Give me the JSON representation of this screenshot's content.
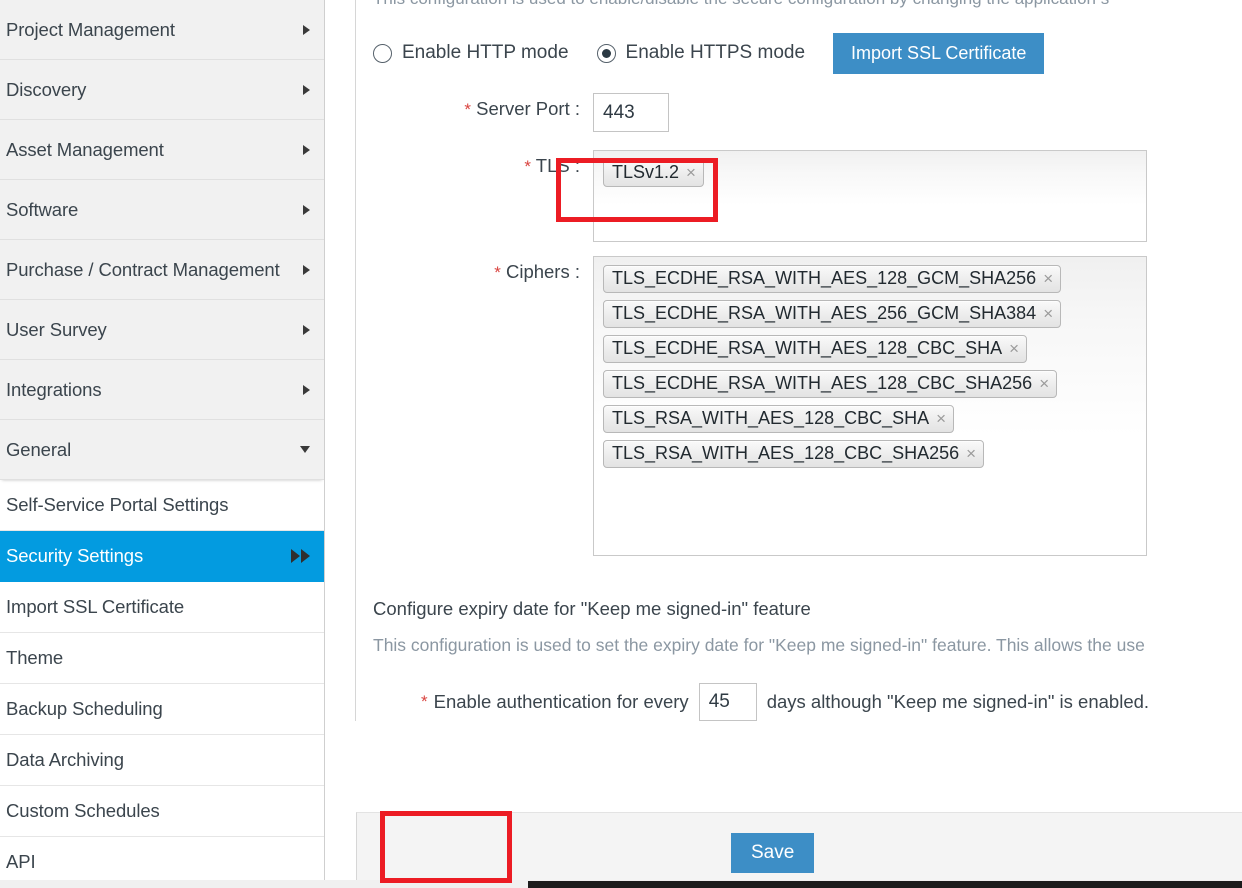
{
  "sidebar": {
    "groups": [
      {
        "label": "Project Management",
        "icon": "chevron-right-icon",
        "expanded": false
      },
      {
        "label": "Discovery",
        "icon": "chevron-right-icon",
        "expanded": false
      },
      {
        "label": "Asset Management",
        "icon": "chevron-right-icon",
        "expanded": false
      },
      {
        "label": "Software",
        "icon": "chevron-right-icon",
        "expanded": false
      },
      {
        "label": "Purchase / Contract Management",
        "icon": "chevron-right-icon",
        "expanded": false
      },
      {
        "label": "User Survey",
        "icon": "chevron-right-icon",
        "expanded": false
      },
      {
        "label": "Integrations",
        "icon": "chevron-right-icon",
        "expanded": false
      },
      {
        "label": "General",
        "icon": "chevron-down-icon",
        "expanded": true
      }
    ],
    "sub_items": [
      {
        "label": "Self-Service Portal Settings",
        "active": false
      },
      {
        "label": "Security Settings",
        "active": true,
        "icon": "double-arrow-right-icon"
      },
      {
        "label": "Import SSL Certificate",
        "active": false
      },
      {
        "label": "Theme",
        "active": false
      },
      {
        "label": "Backup Scheduling",
        "active": false
      },
      {
        "label": "Data Archiving",
        "active": false
      },
      {
        "label": "Custom Schedules",
        "active": false
      },
      {
        "label": "API",
        "active": false
      }
    ],
    "active_color": "#039BE0"
  },
  "main": {
    "top_description": "This configuration is used to enable/disable the secure configuration by changing the application s",
    "http_mode": {
      "label": "Enable HTTP mode",
      "checked": false
    },
    "https_mode": {
      "label": "Enable HTTPS mode",
      "checked": true
    },
    "import_ssl_button": "Import SSL Certificate",
    "server_port": {
      "label": "Server Port :",
      "required": true,
      "value": "443"
    },
    "tls": {
      "label": "TLS :",
      "required": true,
      "tags": [
        "TLSv1.2"
      ],
      "remove_icon": "×"
    },
    "ciphers": {
      "label": "Ciphers :",
      "required": true,
      "tags": [
        "TLS_ECDHE_RSA_WITH_AES_128_GCM_SHA256",
        "TLS_ECDHE_RSA_WITH_AES_256_GCM_SHA384",
        "TLS_ECDHE_RSA_WITH_AES_128_CBC_SHA",
        "TLS_ECDHE_RSA_WITH_AES_128_CBC_SHA256",
        "TLS_RSA_WITH_AES_128_CBC_SHA",
        "TLS_RSA_WITH_AES_128_CBC_SHA256"
      ],
      "remove_icon": "×"
    },
    "keep_signed_in": {
      "title": "Configure expiry date for \"Keep me signed-in\" feature",
      "description": "This configuration is used to set the expiry date for \"Keep me signed-in\" feature. This allows the use",
      "prefix_text": "Enable authentication for every",
      "days_value": "45",
      "suffix_text": "days although \"Keep me signed-in\" is enabled.",
      "required": true
    },
    "save_button": "Save",
    "accent_blue": "#3d8ec6",
    "required_marker": "*",
    "annotation_color": "#ec1c24"
  }
}
